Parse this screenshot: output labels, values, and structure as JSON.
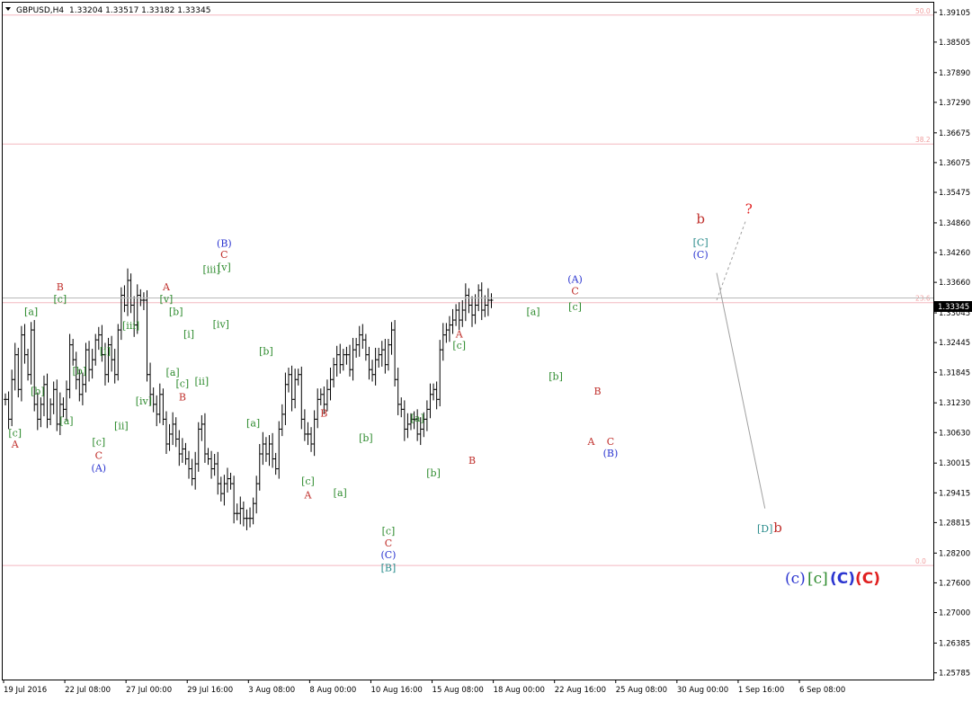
{
  "header": {
    "symbol": "GBPUSD,H4",
    "ohlc": "1.33204 1.33517 1.33182 1.33345"
  },
  "price_tag": "1.33345",
  "colors": {
    "candle": "#000000",
    "fib_line": "#f4b8c0",
    "fib_text": "#f0a0a0",
    "wave_red": "#c0302c",
    "wave_green": "#2e8b2e",
    "wave_blue": "#2b35d0",
    "wave_teal": "#2a8c8c",
    "projection": "#a0a0a0",
    "question": "#e02020"
  },
  "fib_levels": [
    {
      "label": "50.0",
      "price": 1.3905
    },
    {
      "label": "38.2",
      "price": 1.3645
    },
    {
      "label": "23.6",
      "price": 1.3325
    },
    {
      "label": "0.0",
      "price": 1.2795
    }
  ],
  "big_labels": [
    {
      "text": "(c)",
      "color": "#2b35d0",
      "bold": false
    },
    {
      "text": "[c]",
      "color": "#2e8b2e",
      "bold": false
    },
    {
      "text": "(C)",
      "color": "#2b35d0",
      "bold": true
    },
    {
      "text": "(C)",
      "color": "#e02020",
      "bold": true
    }
  ],
  "chart_data": {
    "type": "candlestick",
    "symbol": "GBPUSD",
    "timeframe": "H4",
    "x_ticks": [
      "19 Jul 2016",
      "22 Jul 08:00",
      "27 Jul 00:00",
      "29 Jul 16:00",
      "3 Aug 08:00",
      "8 Aug 00:00",
      "10 Aug 16:00",
      "15 Aug 08:00",
      "18 Aug 00:00",
      "22 Aug 16:00",
      "25 Aug 08:00",
      "30 Aug 00:00",
      "1 Sep 16:00",
      "6 Sep 08:00"
    ],
    "y_ticks": [
      "1.39105",
      "1.38505",
      "1.37890",
      "1.37290",
      "1.36675",
      "1.36075",
      "1.35475",
      "1.34860",
      "1.34260",
      "1.33660",
      "1.33045",
      "1.32445",
      "1.31845",
      "1.31230",
      "1.30630",
      "1.30015",
      "1.29415",
      "1.28815",
      "1.28200",
      "1.27600",
      "1.27000",
      "1.26385",
      "1.25785"
    ],
    "ylim": [
      1.2565,
      1.393
    ],
    "close_series": [
      1.313,
      1.309,
      1.317,
      1.322,
      1.315,
      1.326,
      1.322,
      1.318,
      1.327,
      1.312,
      1.309,
      1.312,
      1.316,
      1.309,
      1.312,
      1.315,
      1.308,
      1.312,
      1.311,
      1.315,
      1.324,
      1.321,
      1.317,
      1.314,
      1.316,
      1.323,
      1.319,
      1.321,
      1.325,
      1.326,
      1.322,
      1.318,
      1.324,
      1.321,
      1.318,
      1.327,
      1.334,
      1.332,
      1.337,
      1.332,
      1.328,
      1.334,
      1.333,
      1.333,
      1.318,
      1.314,
      1.312,
      1.31,
      1.314,
      1.309,
      1.304,
      1.306,
      1.308,
      1.305,
      1.302,
      1.303,
      1.301,
      1.299,
      1.297,
      1.3,
      1.307,
      1.308,
      1.302,
      1.301,
      1.299,
      1.3,
      1.296,
      1.294,
      1.296,
      1.297,
      1.296,
      1.29,
      1.29,
      1.291,
      1.289,
      1.289,
      1.289,
      1.292,
      1.296,
      1.302,
      1.304,
      1.302,
      1.304,
      1.301,
      1.299,
      1.307,
      1.31,
      1.316,
      1.318,
      1.313,
      1.317,
      1.318,
      1.309,
      1.306,
      1.306,
      1.304,
      1.309,
      1.313,
      1.314,
      1.312,
      1.315,
      1.317,
      1.32,
      1.322,
      1.32,
      1.322,
      1.322,
      1.319,
      1.323,
      1.324,
      1.326,
      1.325,
      1.322,
      1.319,
      1.318,
      1.321,
      1.322,
      1.323,
      1.32,
      1.324,
      1.327,
      1.317,
      1.312,
      1.311,
      1.307,
      1.308,
      1.309,
      1.309,
      1.306,
      1.307,
      1.309,
      1.311,
      1.314,
      1.315,
      1.313,
      1.323,
      1.326,
      1.327,
      1.328,
      1.329,
      1.331,
      1.329,
      1.331,
      1.334,
      1.332,
      1.33,
      1.332,
      1.335,
      1.331,
      1.332,
      1.333,
      1.333
    ],
    "wave_labels": [
      {
        "text": "A",
        "color": "#c0302c",
        "bar": 3,
        "price": 1.3033
      },
      {
        "text": "[c]",
        "color": "#2e8b2e",
        "bar": 3,
        "price": 1.3055
      },
      {
        "text": "[a]",
        "color": "#2e8b2e",
        "bar": 8,
        "price": 1.33
      },
      {
        "text": "[b]",
        "color": "#2e8b2e",
        "bar": 10,
        "price": 1.314
      },
      {
        "text": "B",
        "color": "#c0302c",
        "bar": 17,
        "price": 1.335
      },
      {
        "text": "[c]",
        "color": "#2e8b2e",
        "bar": 17,
        "price": 1.3325
      },
      {
        "text": "[a]",
        "color": "#2e8b2e",
        "bar": 19,
        "price": 1.308
      },
      {
        "text": "[b]",
        "color": "#2e8b2e",
        "bar": 23,
        "price": 1.318
      },
      {
        "text": "[c]",
        "color": "#2e8b2e",
        "bar": 29,
        "price": 1.3037
      },
      {
        "text": "C",
        "color": "#c0302c",
        "bar": 29,
        "price": 1.301
      },
      {
        "text": "(A)",
        "color": "#2b35d0",
        "bar": 29,
        "price": 1.2985
      },
      {
        "text": "[i]",
        "color": "#2e8b2e",
        "bar": 31,
        "price": 1.322
      },
      {
        "text": "[ii]",
        "color": "#2e8b2e",
        "bar": 36,
        "price": 1.307
      },
      {
        "text": "[iii]",
        "color": "#2e8b2e",
        "bar": 39,
        "price": 1.3272
      },
      {
        "text": "[iv]",
        "color": "#2e8b2e",
        "bar": 43,
        "price": 1.312
      },
      {
        "text": "A",
        "color": "#c0302c",
        "bar": 50,
        "price": 1.335
      },
      {
        "text": "[v]",
        "color": "#2e8b2e",
        "bar": 50,
        "price": 1.3325
      },
      {
        "text": "[b]",
        "color": "#2e8b2e",
        "bar": 53,
        "price": 1.33
      },
      {
        "text": "[a]",
        "color": "#2e8b2e",
        "bar": 52,
        "price": 1.3178
      },
      {
        "text": "[i]",
        "color": "#2e8b2e",
        "bar": 57,
        "price": 1.3255
      },
      {
        "text": "[c]",
        "color": "#2e8b2e",
        "bar": 55,
        "price": 1.3155
      },
      {
        "text": "B",
        "color": "#c0302c",
        "bar": 55,
        "price": 1.3128
      },
      {
        "text": "[ii]",
        "color": "#2e8b2e",
        "bar": 61,
        "price": 1.316
      },
      {
        "text": "(B)",
        "color": "#2b35d0",
        "bar": 68,
        "price": 1.3438
      },
      {
        "text": "C",
        "color": "#c0302c",
        "bar": 68,
        "price": 1.3415
      },
      {
        "text": "[iii]",
        "color": "#2e8b2e",
        "bar": 64,
        "price": 1.3385
      },
      {
        "text": "[v]",
        "color": "#2e8b2e",
        "bar": 68,
        "price": 1.339
      },
      {
        "text": "[iv]",
        "color": "#2e8b2e",
        "bar": 67,
        "price": 1.3275
      },
      {
        "text": "[b]",
        "color": "#2e8b2e",
        "bar": 81,
        "price": 1.322
      },
      {
        "text": "[a]",
        "color": "#2e8b2e",
        "bar": 77,
        "price": 1.3075
      },
      {
        "text": "B",
        "color": "#c0302c",
        "bar": 99,
        "price": 1.3095
      },
      {
        "text": "[c]",
        "color": "#2e8b2e",
        "bar": 94,
        "price": 1.2958
      },
      {
        "text": "A",
        "color": "#c0302c",
        "bar": 94,
        "price": 1.293
      },
      {
        "text": "[a]",
        "color": "#2e8b2e",
        "bar": 104,
        "price": 1.2935
      },
      {
        "text": "[b]",
        "color": "#2e8b2e",
        "bar": 112,
        "price": 1.3045
      },
      {
        "text": "[c]",
        "color": "#2e8b2e",
        "bar": 119,
        "price": 1.2858
      },
      {
        "text": "C",
        "color": "#c0302c",
        "bar": 119,
        "price": 1.2833
      },
      {
        "text": "(C)",
        "color": "#2b35d0",
        "bar": 119,
        "price": 1.281
      },
      {
        "text": "[B]",
        "color": "#2a8c8c",
        "bar": 119,
        "price": 1.2783
      },
      {
        "text": "[a]",
        "color": "#2e8b2e",
        "bar": 128,
        "price": 1.3085
      },
      {
        "text": "[b]",
        "color": "#2e8b2e",
        "bar": 133,
        "price": 1.2975
      },
      {
        "text": "A",
        "color": "#c0302c",
        "bar": 141,
        "price": 1.3255
      },
      {
        "text": "[c]",
        "color": "#2e8b2e",
        "bar": 141,
        "price": 1.3232
      },
      {
        "text": "B",
        "color": "#c0302c",
        "bar": 145,
        "price": 1.3
      },
      {
        "text": "[a]",
        "color": "#2e8b2e",
        "bar": 164,
        "price": 1.33
      },
      {
        "text": "[b]",
        "color": "#2e8b2e",
        "bar": 171,
        "price": 1.317
      },
      {
        "text": "(A)",
        "color": "#2b35d0",
        "bar": 177,
        "price": 1.3365
      },
      {
        "text": "C",
        "color": "#c0302c",
        "bar": 177,
        "price": 1.3342
      },
      {
        "text": "[c]",
        "color": "#2e8b2e",
        "bar": 177,
        "price": 1.331
      },
      {
        "text": "B",
        "color": "#c0302c",
        "bar": 184,
        "price": 1.314
      },
      {
        "text": "A",
        "color": "#c0302c",
        "bar": 182,
        "price": 1.3038
      },
      {
        "text": "C",
        "color": "#c0302c",
        "bar": 188,
        "price": 1.3038
      },
      {
        "text": "(B)",
        "color": "#2b35d0",
        "bar": 188,
        "price": 1.3015
      },
      {
        "text": "b",
        "color": "#c0302c",
        "bar": 216,
        "price": 1.3485
      },
      {
        "text": "[C]",
        "color": "#2a8c8c",
        "bar": 216,
        "price": 1.344
      },
      {
        "text": "(C)",
        "color": "#2b35d0",
        "bar": 216,
        "price": 1.3415
      },
      {
        "text": "?",
        "color": "#e02020",
        "bar": 231,
        "price": 1.3505
      },
      {
        "text": "[D]",
        "color": "#2a8c8c",
        "bar": 236,
        "price": 1.2862
      },
      {
        "text": "b",
        "color": "#c0302c",
        "bar": 240,
        "price": 1.2862
      }
    ],
    "projection": [
      {
        "bar": 221,
        "price": 1.3385,
        "to_bar": 236,
        "to_price": 1.291
      },
      {
        "bar": 221,
        "price": 1.333,
        "to_bar": 230,
        "to_price": 1.349
      }
    ],
    "grid": false,
    "price_tag": 1.33345
  }
}
